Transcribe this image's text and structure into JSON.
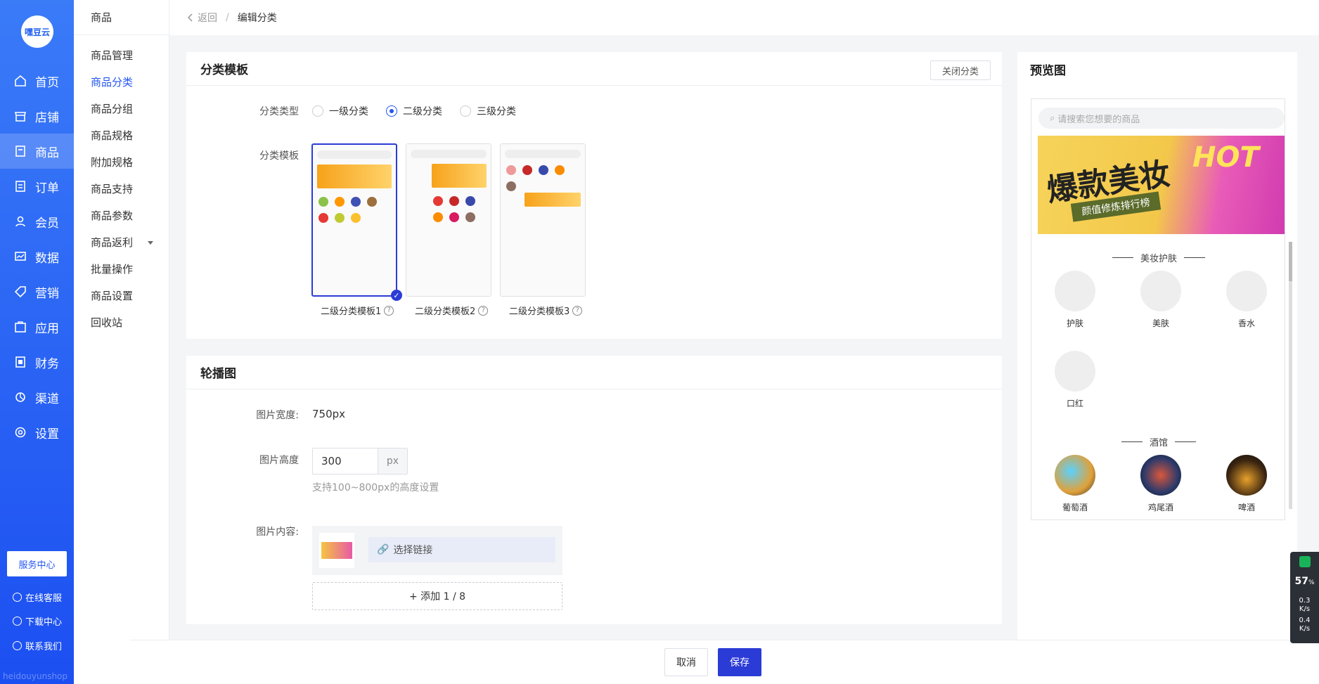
{
  "app": {
    "logo_text": "嘿豆云",
    "brand": "heidouyunshop"
  },
  "nav": [
    {
      "label": "首页",
      "icon": "home-icon"
    },
    {
      "label": "店铺",
      "icon": "store-icon"
    },
    {
      "label": "商品",
      "icon": "goods-icon"
    },
    {
      "label": "订单",
      "icon": "order-icon"
    },
    {
      "label": "会员",
      "icon": "user-icon"
    },
    {
      "label": "数据",
      "icon": "chart-icon"
    },
    {
      "label": "营销",
      "icon": "tag-icon"
    },
    {
      "label": "应用",
      "icon": "app-icon"
    },
    {
      "label": "财务",
      "icon": "finance-icon"
    },
    {
      "label": "渠道",
      "icon": "channel-icon"
    },
    {
      "label": "设置",
      "icon": "gear-icon"
    }
  ],
  "side_bottom": {
    "service": "服务中心",
    "online": "在线客服",
    "download": "下载中心",
    "contact": "联系我们"
  },
  "subnav": {
    "title": "商品",
    "items": [
      "商品管理",
      "商品分类",
      "商品分组",
      "商品规格",
      "附加规格",
      "商品支持",
      "商品参数",
      "商品返利",
      "批量操作",
      "商品设置",
      "回收站"
    ]
  },
  "breadcrumb": {
    "back": "返回",
    "sep": "/",
    "current": "编辑分类"
  },
  "template_card": {
    "title": "分类模板",
    "close_btn": "关闭分类",
    "type_label": "分类类型",
    "types": [
      "一级分类",
      "二级分类",
      "三级分类"
    ],
    "selected_type": "二级分类",
    "tpl_label": "分类模板",
    "templates": [
      "二级分类模板1",
      "二级分类模板2",
      "二级分类模板3"
    ]
  },
  "carousel_card": {
    "title": "轮播图",
    "width_label": "图片宽度:",
    "width_value": "750px",
    "height_label": "图片高度",
    "height_value": "300",
    "height_unit": "px",
    "height_hint": "支持100~800px的高度设置",
    "content_label": "图片内容:",
    "link_btn": "选择链接",
    "add_btn": "+ 添加 1 / 8"
  },
  "footer": {
    "cancel": "取消",
    "save": "保存"
  },
  "preview": {
    "title": "预览图",
    "search_placeholder": "请搜索您想要的商品",
    "banner_text": "爆款美妆",
    "banner_sub": "颜值修炼排行榜",
    "banner_hot": "HOT",
    "section1": "美妆护肤",
    "section1_items": [
      "护肤",
      "美肤",
      "香水",
      "口红"
    ],
    "section2": "酒馆",
    "section2_items": [
      "葡萄酒",
      "鸡尾酒",
      "啤酒"
    ]
  },
  "widget": {
    "percent": "57",
    "pct_unit": "%",
    "up": "0.3",
    "down": "0.4",
    "unit": "K/s"
  },
  "colors": {
    "primary": "#2456f0",
    "sidebar_top": "#3a7bf8",
    "sidebar_bottom": "#1c4ff1",
    "save": "#2b3bd6"
  }
}
